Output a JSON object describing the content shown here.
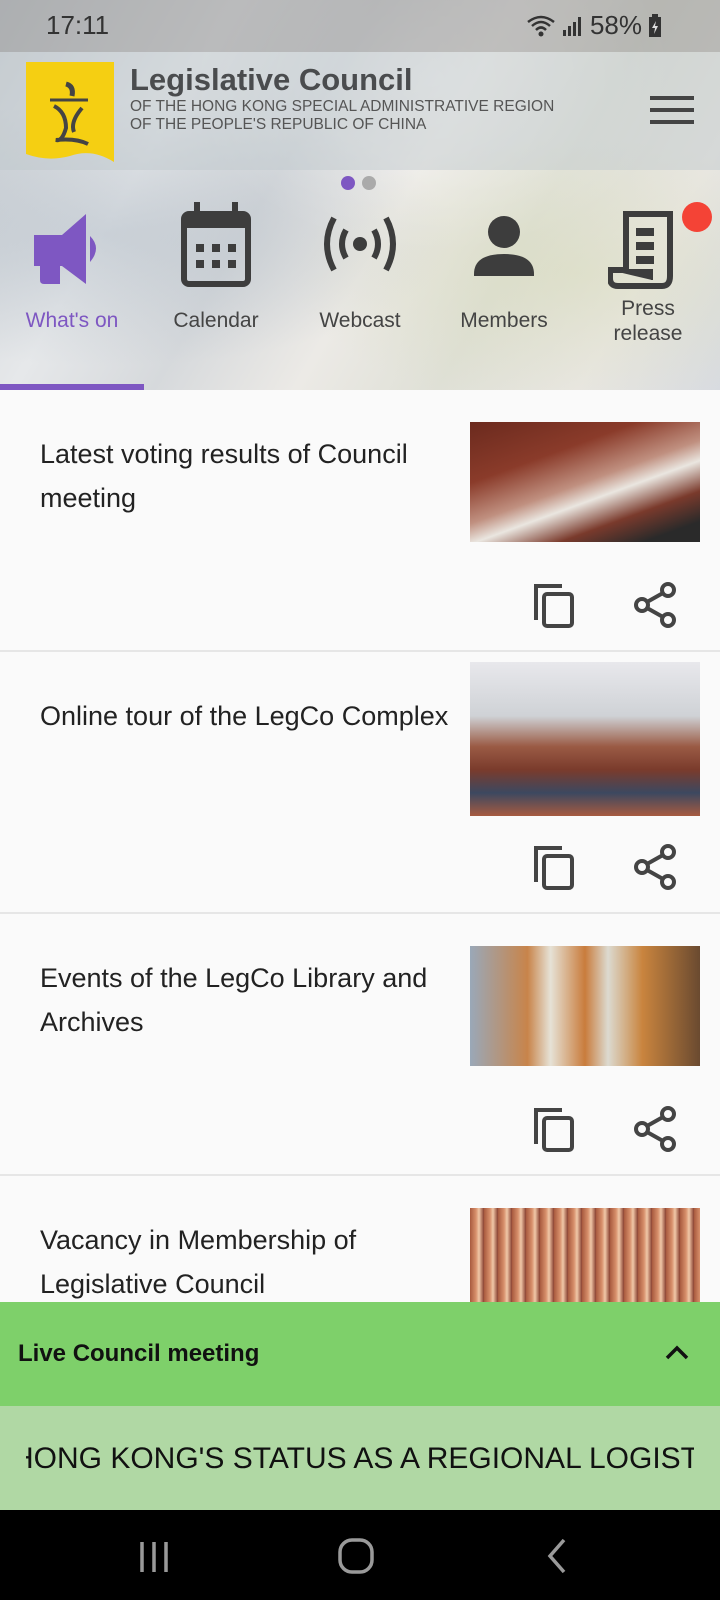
{
  "status_bar": {
    "time": "17:11",
    "battery": "58%",
    "icons": [
      "wifi-icon",
      "signal-icon",
      "battery-charging-icon"
    ]
  },
  "header": {
    "title": "Legislative Council",
    "subtitle_line1": "OF THE HONG KONG SPECIAL ADMINISTRATIVE REGION",
    "subtitle_line2": "OF THE PEOPLE'S REPUBLIC OF CHINA",
    "logo": "legco-logo",
    "menu_icon": "hamburger-menu-icon"
  },
  "pager": {
    "pages": 2,
    "current": 1
  },
  "nav": {
    "items": [
      {
        "label": "What's on",
        "icon": "megaphone-icon",
        "active": true
      },
      {
        "label": "Calendar",
        "icon": "calendar-icon",
        "active": false
      },
      {
        "label": "Webcast",
        "icon": "broadcast-icon",
        "active": false
      },
      {
        "label": "Members",
        "icon": "person-icon",
        "active": false
      },
      {
        "label": "Press release",
        "icon": "press-release-icon",
        "active": false,
        "badge": true
      }
    ]
  },
  "colors": {
    "accent": "#7e57c2",
    "badge": "#f44336",
    "live_bar": "#7ed06a",
    "ticker_bar": "#b0d8a4",
    "logo_yellow": "#f5cf12"
  },
  "items": [
    {
      "title": "Latest voting results of Council meeting",
      "image": "council-chamber-desks"
    },
    {
      "title": "Online tour of the LegCo Complex",
      "image": "legco-chamber-overview"
    },
    {
      "title": "Events of the LegCo Library and Archives",
      "image": "library-bookshelves"
    },
    {
      "title": "Vacancy in Membership of Legislative Council",
      "image": "legco-emblem-wall"
    }
  ],
  "live": {
    "title": "Live Council meeting",
    "ticker": "HONG KONG'S STATUS AS A REGIONAL LOGISTICS"
  }
}
